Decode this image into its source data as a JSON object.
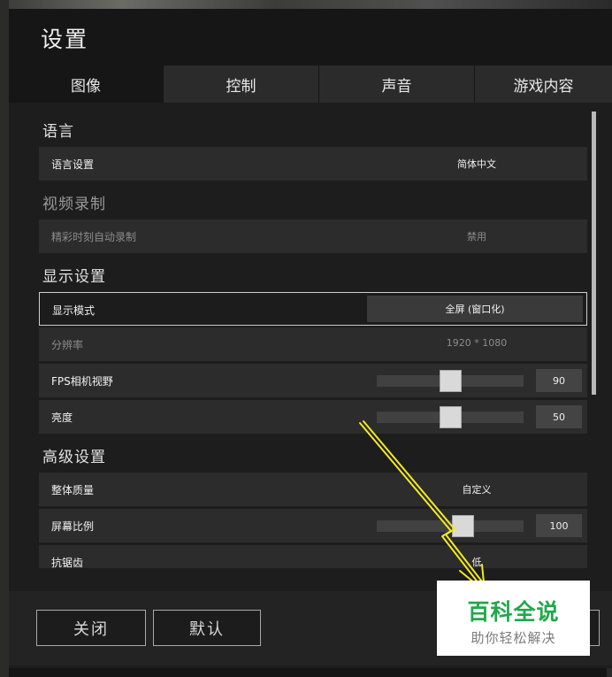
{
  "window": {
    "title": "设置"
  },
  "tabs": [
    {
      "label": "图像",
      "active": true
    },
    {
      "label": "控制",
      "active": false
    },
    {
      "label": "声音",
      "active": false
    },
    {
      "label": "游戏内容",
      "active": false
    }
  ],
  "sections": {
    "language": {
      "heading": "语言",
      "language_setting": {
        "label": "语言设置",
        "value": "简体中文"
      }
    },
    "video_record": {
      "heading": "视频录制",
      "highlight_auto_record": {
        "label": "精彩时刻自动录制",
        "value": "禁用"
      }
    },
    "display": {
      "heading": "显示设置",
      "display_mode": {
        "label": "显示模式",
        "value": "全屏 (窗口化)"
      },
      "resolution": {
        "label": "分辨率",
        "value": "1920 * 1080"
      },
      "fps_fov": {
        "label": "FPS相机视野",
        "value": "90",
        "level": 0.5
      },
      "brightness": {
        "label": "亮度",
        "value": "50",
        "level": 0.5
      }
    },
    "advanced": {
      "heading": "高级设置",
      "overall_quality": {
        "label": "整体质量",
        "value": "自定义"
      },
      "screen_scale": {
        "label": "屏幕比例",
        "value": "100",
        "level": 0.6
      },
      "anti_aliasing": {
        "label": "抗锯齿",
        "value": "低"
      }
    }
  },
  "footer": {
    "close_label": "关闭",
    "default_label": "默认"
  },
  "watermark": {
    "main": "百科全说",
    "sub": "助你轻松解决"
  },
  "colors": {
    "watermark_green": "#21a84a",
    "arrow_yellow": "#f2ea20"
  }
}
